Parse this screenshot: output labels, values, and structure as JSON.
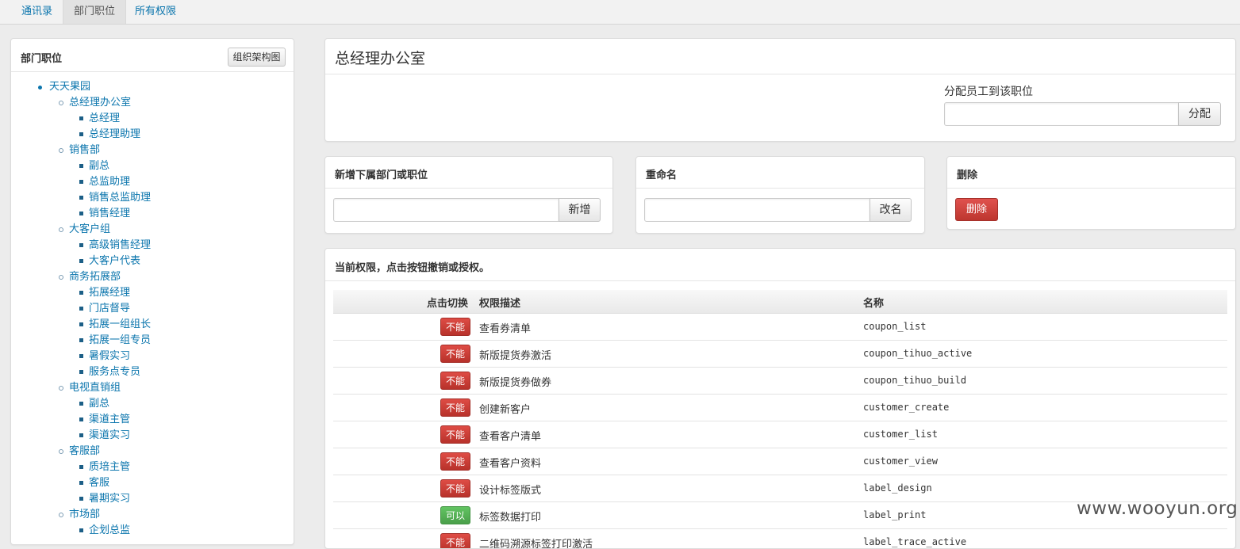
{
  "nav": {
    "tabs": [
      {
        "label": "通讯录",
        "active": false
      },
      {
        "label": "部门职位",
        "active": true
      },
      {
        "label": "所有权限",
        "active": false
      }
    ]
  },
  "sidebar": {
    "title": "部门职位",
    "org_chart_button": "组织架构图",
    "tree": [
      {
        "label": "天天果园",
        "level": 0
      },
      {
        "label": "总经理办公室",
        "level": 1
      },
      {
        "label": "总经理",
        "level": 2
      },
      {
        "label": "总经理助理",
        "level": 2
      },
      {
        "label": "销售部",
        "level": 1
      },
      {
        "label": "副总",
        "level": 2
      },
      {
        "label": "总监助理",
        "level": 2
      },
      {
        "label": "销售总监助理",
        "level": 2
      },
      {
        "label": "销售经理",
        "level": 2
      },
      {
        "label": "大客户组",
        "level": 1
      },
      {
        "label": "高级销售经理",
        "level": 2
      },
      {
        "label": "大客户代表",
        "level": 2
      },
      {
        "label": "商务拓展部",
        "level": 1
      },
      {
        "label": "拓展经理",
        "level": 2
      },
      {
        "label": "门店督导",
        "level": 2
      },
      {
        "label": "拓展一组组长",
        "level": 2
      },
      {
        "label": "拓展一组专员",
        "level": 2
      },
      {
        "label": "暑假实习",
        "level": 2
      },
      {
        "label": "服务点专员",
        "level": 2
      },
      {
        "label": "电视直销组",
        "level": 1
      },
      {
        "label": "副总",
        "level": 2
      },
      {
        "label": "渠道主管",
        "level": 2
      },
      {
        "label": "渠道实习",
        "level": 2
      },
      {
        "label": "客服部",
        "level": 1
      },
      {
        "label": "质培主管",
        "level": 2
      },
      {
        "label": "客服",
        "level": 2
      },
      {
        "label": "暑期实习",
        "level": 2
      },
      {
        "label": "市场部",
        "level": 1
      },
      {
        "label": "企划总监",
        "level": 2
      }
    ]
  },
  "main": {
    "title": "总经理办公室",
    "assign": {
      "label": "分配员工到该职位",
      "input_value": "",
      "button": "分配"
    },
    "add": {
      "title": "新增下属部门或职位",
      "input_value": "",
      "button": "新增"
    },
    "rename": {
      "title": "重命名",
      "input_value": "",
      "button": "改名"
    },
    "delete": {
      "title": "删除",
      "button": "删除"
    },
    "permissions": {
      "title": "当前权限，点击按钮撤销或授权。",
      "headers": {
        "toggle": "点击切换",
        "desc": "权限描述",
        "name": "名称"
      },
      "rows": [
        {
          "state": "不能",
          "granted": false,
          "desc": "查看券清单",
          "name": "coupon_list"
        },
        {
          "state": "不能",
          "granted": false,
          "desc": "新版提货券激活",
          "name": "coupon_tihuo_active"
        },
        {
          "state": "不能",
          "granted": false,
          "desc": "新版提货券做券",
          "name": "coupon_tihuo_build"
        },
        {
          "state": "不能",
          "granted": false,
          "desc": "创建新客户",
          "name": "customer_create"
        },
        {
          "state": "不能",
          "granted": false,
          "desc": "查看客户清单",
          "name": "customer_list"
        },
        {
          "state": "不能",
          "granted": false,
          "desc": "查看客户资料",
          "name": "customer_view"
        },
        {
          "state": "不能",
          "granted": false,
          "desc": "设计标签版式",
          "name": "label_design"
        },
        {
          "state": "可以",
          "granted": true,
          "desc": "标签数据打印",
          "name": "label_print"
        },
        {
          "state": "不能",
          "granted": false,
          "desc": "二维码溯源标签打印激活",
          "name": "label_trace_active"
        }
      ]
    }
  },
  "watermark": "www.wooyun.org"
}
